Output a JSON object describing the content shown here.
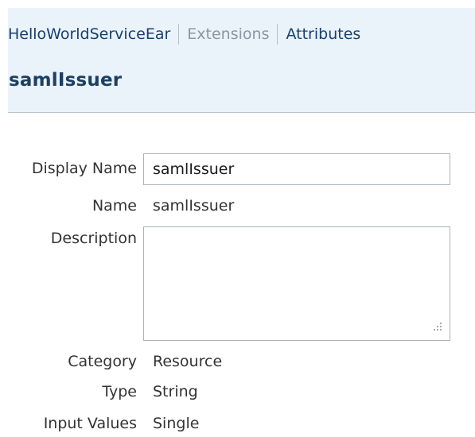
{
  "breadcrumb": {
    "app": "HelloWorldServiceEar",
    "section": "Extensions",
    "current": "Attributes"
  },
  "page_title": "samlIssuer",
  "form": {
    "display_name": {
      "label": "Display Name",
      "value": "samlIssuer"
    },
    "name": {
      "label": "Name",
      "value": "samlIssuer"
    },
    "description": {
      "label": "Description",
      "value": ""
    },
    "category": {
      "label": "Category",
      "value": "Resource"
    },
    "type": {
      "label": "Type",
      "value": "String"
    },
    "input_values": {
      "label": "Input Values",
      "value": "Single"
    }
  },
  "colors": {
    "header_background": "#eaf2fa",
    "link": "#17406f",
    "disabled_link": "#8a96a3",
    "title": "#1d3f63",
    "field_border": "#a9b3bd"
  },
  "icons": {
    "textarea_resize": "resize-grip-icon"
  }
}
